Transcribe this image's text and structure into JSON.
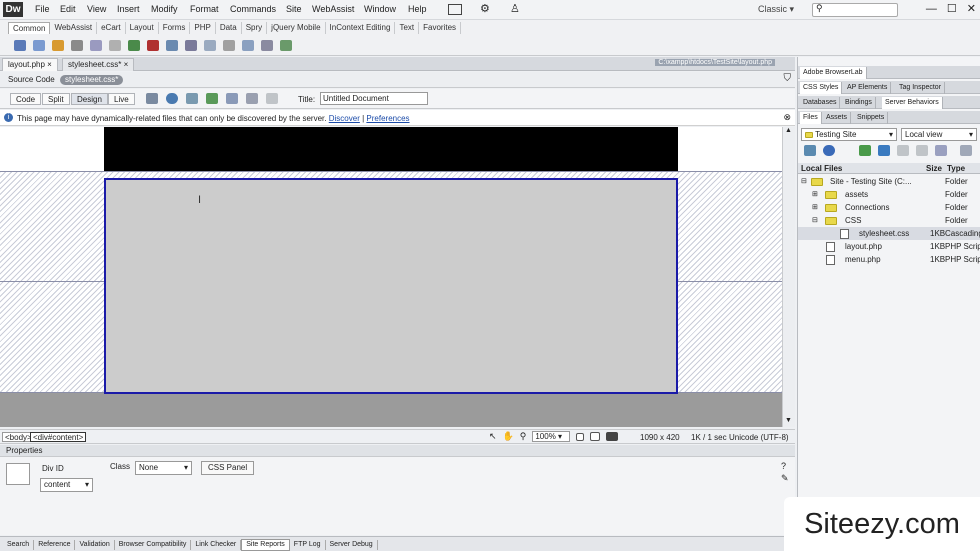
{
  "app": {
    "logo": "Dw"
  },
  "menu": [
    "File",
    "Edit",
    "View",
    "Insert",
    "Modify",
    "Format",
    "Commands",
    "Site",
    "WebAssist",
    "Window",
    "Help"
  ],
  "menu_right": {
    "workspace": "Classic"
  },
  "insert_bar": {
    "tabs": [
      "Common",
      "WebAssist",
      "eCart",
      "Layout",
      "Forms",
      "PHP",
      "Data",
      "Spry",
      "jQuery Mobile",
      "InContext Editing",
      "Text",
      "Favorites"
    ],
    "active": "Common"
  },
  "doc_tabs": [
    {
      "label": "layout.php"
    },
    {
      "label": "stylesheet.css*"
    }
  ],
  "doc_path": "C:\\xampp\\htdocs\\TestSite\\layout.php",
  "related": {
    "source_label": "Source Code",
    "file_pill": "stylesheet.css*"
  },
  "view_buttons": [
    "Code",
    "Split",
    "Design",
    "Live"
  ],
  "title_field": {
    "label": "Title:",
    "value": "Untitled Document"
  },
  "info_bar": {
    "message": "This page may have dynamically-related files that can only be discovered by the server.",
    "discover": "Discover",
    "separator": "|",
    "preferences": "Preferences"
  },
  "status_bar": {
    "tags": [
      "<body>",
      "<div#content>"
    ],
    "zoom": "100%",
    "dimensions": "1090 x 420",
    "transfer": "1K / 1 sec",
    "encoding": "Unicode (UTF-8)"
  },
  "properties": {
    "header": "Properties",
    "div_id_label": "Div ID",
    "div_id_value": "content",
    "class_label": "Class",
    "class_value": "None",
    "css_panel": "CSS Panel"
  },
  "bottom_tabs": [
    "Search",
    "Reference",
    "Validation",
    "Browser Compatibility",
    "Link Checker",
    "Site Reports",
    "FTP Log",
    "Server Debug"
  ],
  "bottom_active": "Site Reports",
  "right_panel": {
    "browserlab": "Adobe BrowserLab",
    "group1": [
      "CSS Styles",
      "AP Elements",
      "Tag Inspector"
    ],
    "group2": [
      "Databases",
      "Bindings",
      "Server Behaviors"
    ],
    "group3": [
      "Files",
      "Assets",
      "Snippets"
    ],
    "site_select": "Testing Site",
    "view_select": "Local view",
    "columns": {
      "name": "Local Files",
      "size": "Size",
      "type": "Type"
    },
    "files": [
      {
        "name": "Site - Testing Site (C:...",
        "size": "",
        "type": "Folder",
        "kind": "folder"
      },
      {
        "name": "assets",
        "size": "",
        "type": "Folder",
        "kind": "folder"
      },
      {
        "name": "Connections",
        "size": "",
        "type": "Folder",
        "kind": "folder"
      },
      {
        "name": "CSS",
        "size": "",
        "type": "Folder",
        "kind": "folder"
      },
      {
        "name": "stylesheet.css",
        "size": "1KB",
        "type": "Cascading",
        "kind": "file"
      },
      {
        "name": "layout.php",
        "size": "1KB",
        "type": "PHP Script",
        "kind": "file"
      },
      {
        "name": "menu.php",
        "size": "1KB",
        "type": "PHP Script",
        "kind": "file"
      }
    ]
  },
  "watermark": "Siteezy.com"
}
